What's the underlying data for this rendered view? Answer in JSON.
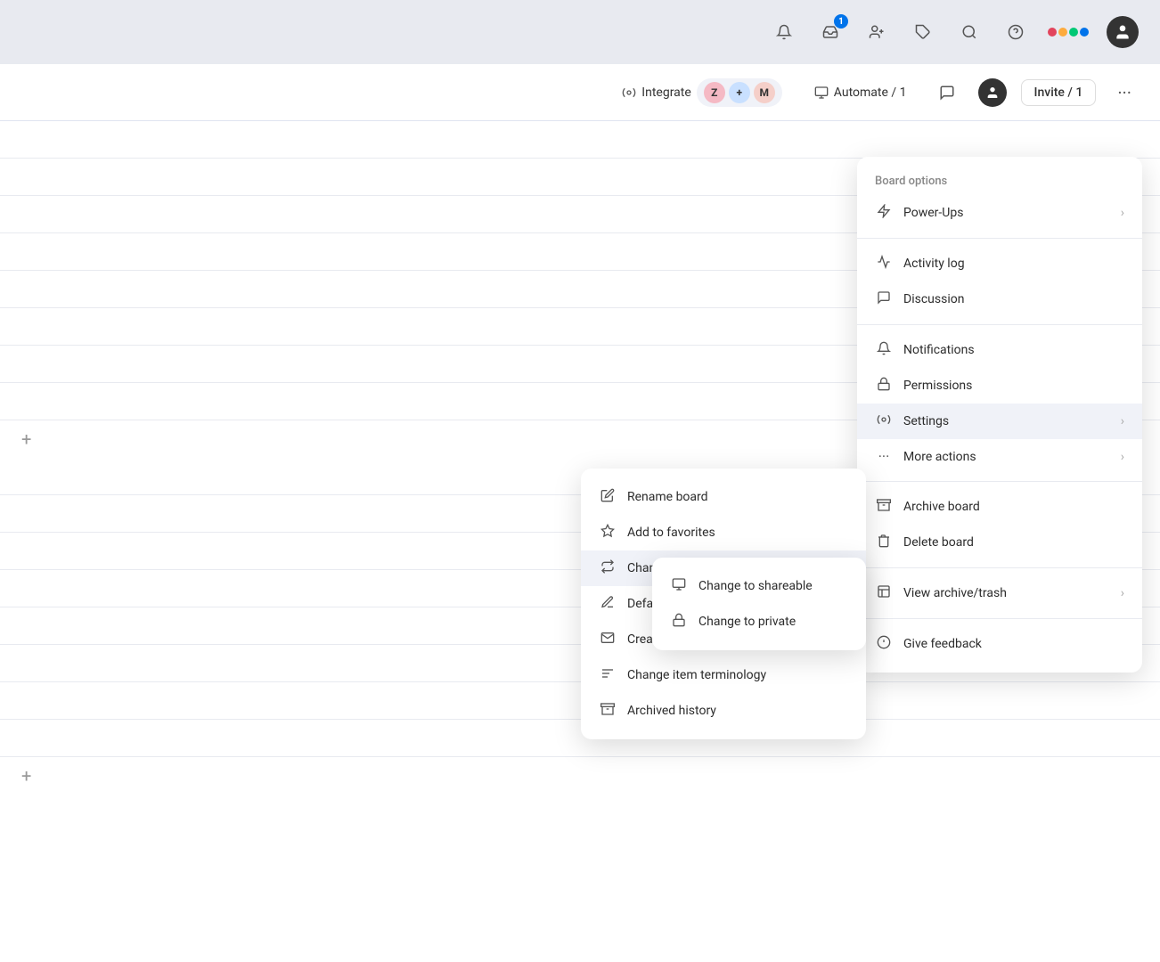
{
  "topNav": {
    "notif_icon": "🔔",
    "inbox_icon": "📥",
    "inbox_badge": "1",
    "invite_icon": "👤+",
    "extensions_icon": "🧩",
    "search_icon": "🔍",
    "help_icon": "?",
    "logo_colors": [
      "#e2445c",
      "#fdab3d",
      "#00c875",
      "#0073ea"
    ],
    "avatar_icon": "👤"
  },
  "secondaryToolbar": {
    "integrate_label": "Integrate",
    "automate_label": "Automate / 1",
    "comment_icon": "💬",
    "invite_label": "Invite / 1",
    "more_icon": "•••",
    "integration_icons": [
      {
        "label": "Z",
        "bg": "#f5b9c4"
      },
      {
        "label": "+",
        "bg": "#c9e0ff"
      },
      {
        "label": "M",
        "bg": "#f5cfc9"
      }
    ]
  },
  "boardOptionsMenu": {
    "title": "Board options",
    "items": [
      {
        "id": "power-ups",
        "label": "Power-Ups",
        "has_arrow": true
      },
      {
        "id": "activity-log",
        "label": "Activity log",
        "has_arrow": false
      },
      {
        "id": "discussion",
        "label": "Discussion",
        "has_arrow": false
      },
      {
        "id": "notifications",
        "label": "Notifications",
        "has_arrow": false
      },
      {
        "id": "permissions",
        "label": "Permissions",
        "has_arrow": false
      },
      {
        "id": "settings",
        "label": "Settings",
        "has_arrow": true,
        "active": true
      },
      {
        "id": "more-actions",
        "label": "More actions",
        "has_arrow": true
      },
      {
        "id": "archive-board",
        "label": "Archive board",
        "has_arrow": false
      },
      {
        "id": "delete-board",
        "label": "Delete board",
        "has_arrow": false
      },
      {
        "id": "view-archive",
        "label": "View archive/trash",
        "has_arrow": true
      },
      {
        "id": "give-feedback",
        "label": "Give feedback",
        "has_arrow": false
      }
    ]
  },
  "moreActionsSubmenu": {
    "items": [
      {
        "id": "rename-board",
        "label": "Rename board"
      },
      {
        "id": "add-favorites",
        "label": "Add to favorites"
      },
      {
        "id": "change-board-type",
        "label": "Change board type",
        "has_arrow": true,
        "active": true
      },
      {
        "id": "default-item-values",
        "label": "Default item values"
      },
      {
        "id": "create-items-email",
        "label": "Create items via email"
      },
      {
        "id": "change-item-terminology",
        "label": "Change item terminology"
      },
      {
        "id": "archived-history",
        "label": "Archived history"
      }
    ]
  },
  "changeBoardTypeSubmenu": {
    "items": [
      {
        "id": "change-shareable",
        "label": "Change to shareable"
      },
      {
        "id": "change-private",
        "label": "Change to private"
      }
    ]
  }
}
